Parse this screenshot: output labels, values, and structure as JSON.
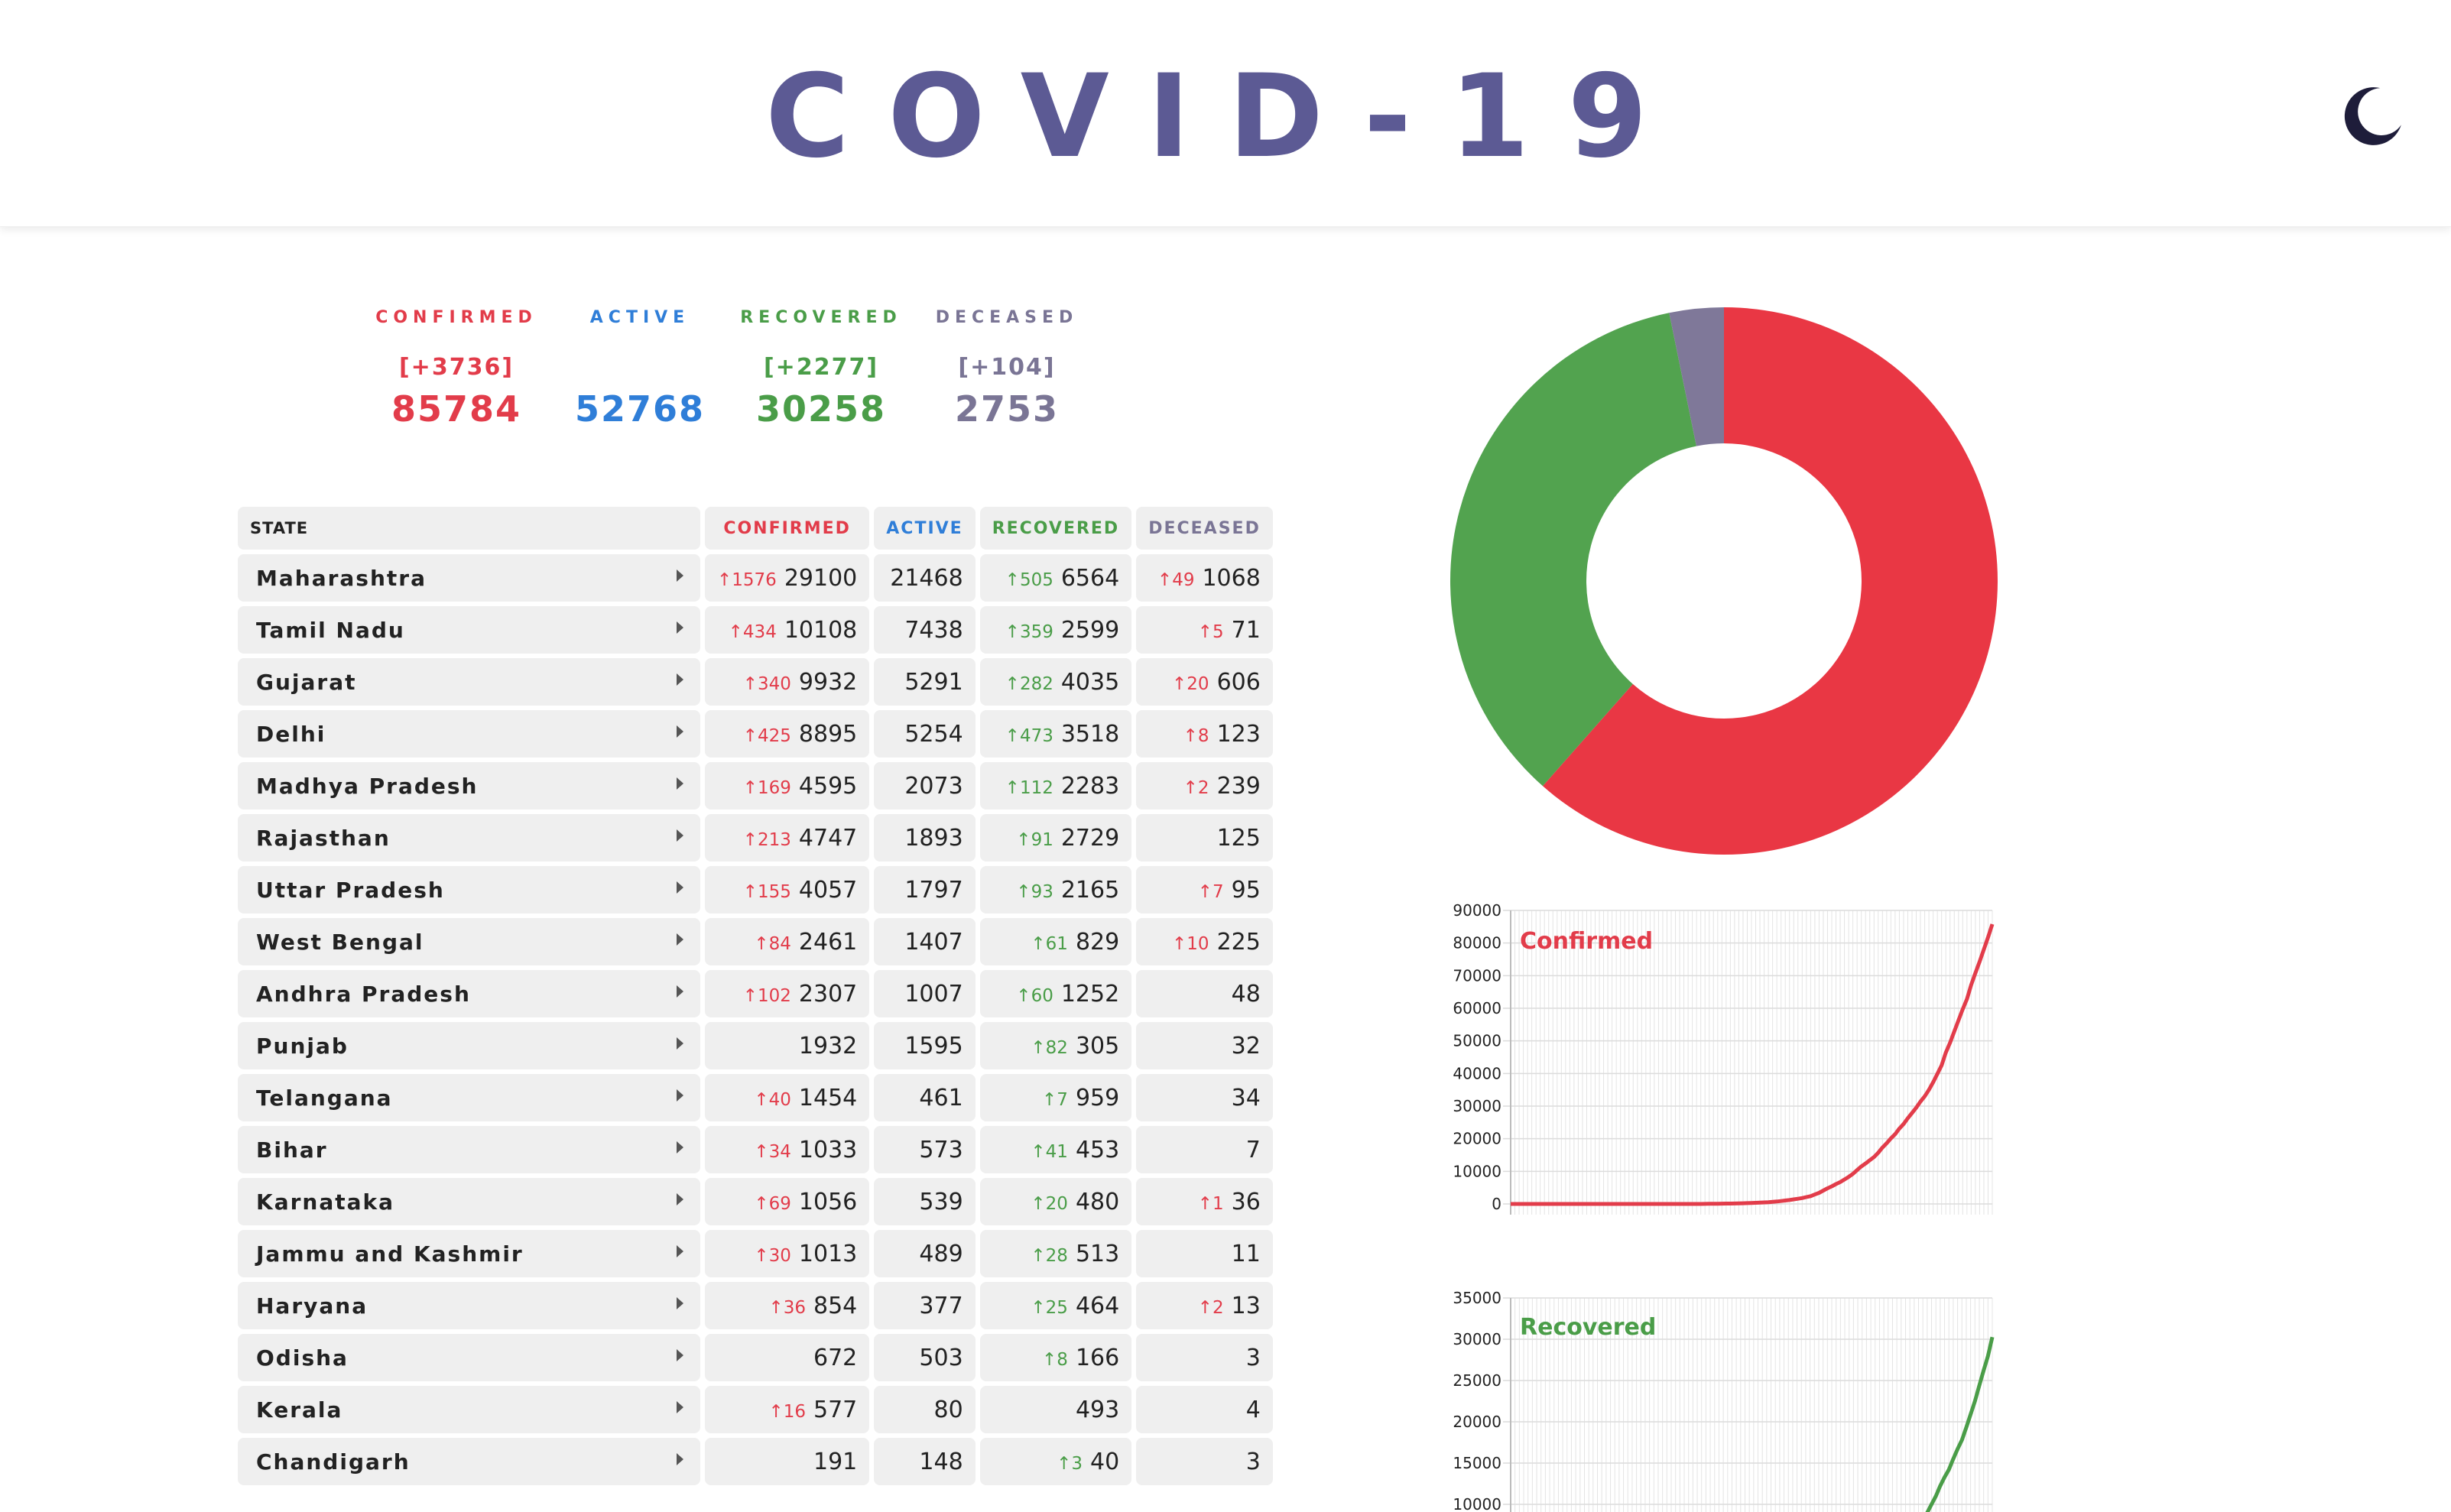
{
  "header": {
    "title": "COVID-19",
    "theme_icon": "moon-icon"
  },
  "summary": {
    "confirmed": {
      "label": "CONFIRMED",
      "delta": "[+3736]",
      "total": "85784",
      "color": "#e23c4a"
    },
    "active": {
      "label": "ACTIVE",
      "delta": "",
      "total": "52768",
      "color": "#2f7ed8"
    },
    "recovered": {
      "label": "RECOVERED",
      "delta": "[+2277]",
      "total": "30258",
      "color": "#4a9d48"
    },
    "deceased": {
      "label": "DECEASED",
      "delta": "[+104]",
      "total": "2753",
      "color": "#7a7595"
    }
  },
  "table": {
    "headers": {
      "state": "STATE",
      "confirmed": "CONFIRMED",
      "active": "ACTIVE",
      "recovered": "RECOVERED",
      "deceased": "DECEASED"
    },
    "rows": [
      {
        "state": "Maharashtra",
        "cd": "1576",
        "c": "29100",
        "a": "21468",
        "rd": "505",
        "r": "6564",
        "dd": "49",
        "d": "1068"
      },
      {
        "state": "Tamil Nadu",
        "cd": "434",
        "c": "10108",
        "a": "7438",
        "rd": "359",
        "r": "2599",
        "dd": "5",
        "d": "71"
      },
      {
        "state": "Gujarat",
        "cd": "340",
        "c": "9932",
        "a": "5291",
        "rd": "282",
        "r": "4035",
        "dd": "20",
        "d": "606"
      },
      {
        "state": "Delhi",
        "cd": "425",
        "c": "8895",
        "a": "5254",
        "rd": "473",
        "r": "3518",
        "dd": "8",
        "d": "123"
      },
      {
        "state": "Madhya Pradesh",
        "cd": "169",
        "c": "4595",
        "a": "2073",
        "rd": "112",
        "r": "2283",
        "dd": "2",
        "d": "239"
      },
      {
        "state": "Rajasthan",
        "cd": "213",
        "c": "4747",
        "a": "1893",
        "rd": "91",
        "r": "2729",
        "dd": "",
        "d": "125"
      },
      {
        "state": "Uttar Pradesh",
        "cd": "155",
        "c": "4057",
        "a": "1797",
        "rd": "93",
        "r": "2165",
        "dd": "7",
        "d": "95"
      },
      {
        "state": "West Bengal",
        "cd": "84",
        "c": "2461",
        "a": "1407",
        "rd": "61",
        "r": "829",
        "dd": "10",
        "d": "225"
      },
      {
        "state": "Andhra Pradesh",
        "cd": "102",
        "c": "2307",
        "a": "1007",
        "rd": "60",
        "r": "1252",
        "dd": "",
        "d": "48"
      },
      {
        "state": "Punjab",
        "cd": "",
        "c": "1932",
        "a": "1595",
        "rd": "82",
        "r": "305",
        "dd": "",
        "d": "32"
      },
      {
        "state": "Telangana",
        "cd": "40",
        "c": "1454",
        "a": "461",
        "rd": "7",
        "r": "959",
        "dd": "",
        "d": "34"
      },
      {
        "state": "Bihar",
        "cd": "34",
        "c": "1033",
        "a": "573",
        "rd": "41",
        "r": "453",
        "dd": "",
        "d": "7"
      },
      {
        "state": "Karnataka",
        "cd": "69",
        "c": "1056",
        "a": "539",
        "rd": "20",
        "r": "480",
        "dd": "1",
        "d": "36"
      },
      {
        "state": "Jammu and Kashmir",
        "cd": "30",
        "c": "1013",
        "a": "489",
        "rd": "28",
        "r": "513",
        "dd": "",
        "d": "11"
      },
      {
        "state": "Haryana",
        "cd": "36",
        "c": "854",
        "a": "377",
        "rd": "25",
        "r": "464",
        "dd": "2",
        "d": "13"
      },
      {
        "state": "Odisha",
        "cd": "",
        "c": "672",
        "a": "503",
        "rd": "8",
        "r": "166",
        "dd": "",
        "d": "3"
      },
      {
        "state": "Kerala",
        "cd": "16",
        "c": "577",
        "a": "80",
        "rd": "",
        "r": "493",
        "dd": "",
        "d": "4"
      },
      {
        "state": "Chandigarh",
        "cd": "",
        "c": "191",
        "a": "148",
        "rd": "3",
        "r": "40",
        "dd": "",
        "d": "3"
      }
    ]
  },
  "chart_data": [
    {
      "type": "pie",
      "labels": [
        "",
        "",
        ""
      ],
      "values": [
        52768,
        30258,
        2753
      ],
      "colors": [
        "#e93744",
        "#52a34f",
        "#7f7899"
      ],
      "donut": true
    },
    {
      "type": "line",
      "title": "Confirmed",
      "color": "#e23c4a",
      "yticks": [
        0,
        10000,
        20000,
        30000,
        40000,
        50000,
        60000,
        70000,
        80000,
        90000
      ],
      "ylim": [
        0,
        90000
      ],
      "y": [
        0,
        0,
        0,
        0,
        0,
        0,
        0,
        0,
        0,
        0,
        0,
        0,
        0,
        0,
        0,
        0,
        0,
        0,
        0,
        0,
        0,
        0,
        0,
        0,
        0,
        0,
        0,
        0,
        0,
        0,
        0,
        0,
        1,
        1,
        1,
        2,
        3,
        3,
        3,
        5,
        5,
        5,
        6,
        6,
        6,
        7,
        30,
        40,
        60,
        75,
        85,
        110,
        125,
        150,
        175,
        200,
        250,
        300,
        350,
        400,
        470,
        550,
        650,
        750,
        900,
        1050,
        1200,
        1400,
        1600,
        1800,
        2100,
        2400,
        2900,
        3400,
        4100,
        4800,
        5400,
        6100,
        6700,
        7500,
        8300,
        9200,
        10400,
        11500,
        12400,
        13400,
        14400,
        15700,
        17300,
        18600,
        20100,
        21400,
        23100,
        24500,
        26300,
        27900,
        29500,
        31400,
        33000,
        35000,
        37300,
        39900,
        42500,
        46400,
        49400,
        52900,
        56300,
        59700,
        62800,
        67200,
        70800,
        74300,
        78000,
        81800,
        85784
      ]
    },
    {
      "type": "line",
      "title": "Recovered",
      "color": "#4a9d48",
      "yticks": [
        10000,
        15000,
        20000,
        25000,
        30000,
        35000
      ],
      "ylim": [
        0,
        35000
      ],
      "y": [
        0,
        0,
        0,
        0,
        0,
        0,
        0,
        0,
        0,
        0,
        0,
        0,
        0,
        0,
        0,
        0,
        0,
        0,
        0,
        0,
        0,
        0,
        0,
        0,
        0,
        0,
        0,
        0,
        0,
        0,
        0,
        0,
        0,
        0,
        0,
        0,
        0,
        0,
        0,
        0,
        3,
        3,
        3,
        3,
        3,
        3,
        3,
        3,
        3,
        3,
        3,
        3,
        3,
        3,
        3,
        3,
        4,
        4,
        10,
        13,
        13,
        17,
        22,
        25,
        40,
        43,
        70,
        84,
        100,
        140,
        160,
        190,
        200,
        250,
        310,
        390,
        470,
        600,
        720,
        960,
        1050,
        1350,
        1500,
        1800,
        2000,
        2300,
        2550,
        2900,
        3250,
        3900,
        4320,
        5050,
        5920,
        6680,
        7500,
        8300,
        9000,
        10000,
        11000,
        12250,
        13300,
        14200,
        15500,
        16700,
        17800,
        19300,
        20900,
        22500,
        24400,
        26200,
        27950,
        30258
      ]
    }
  ]
}
